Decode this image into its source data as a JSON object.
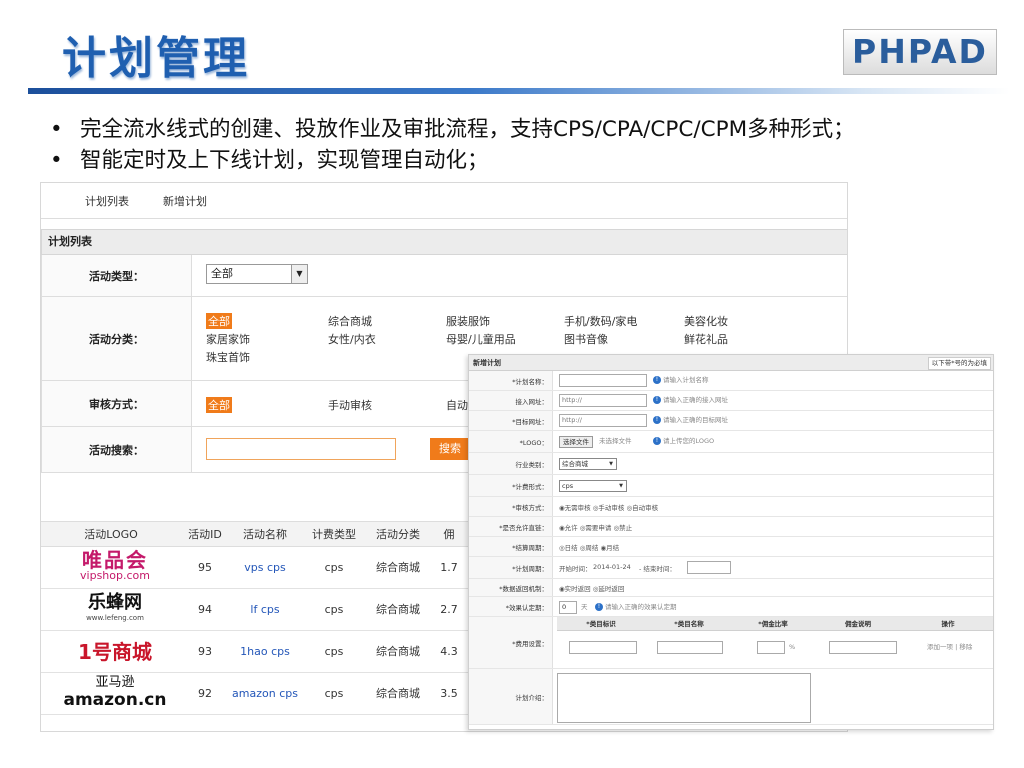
{
  "slide": {
    "title": "计划管理",
    "logo": "PHPAD",
    "bullets": [
      "完全流水线式的创建、投放作业及审批流程，支持CPS/CPA/CPC/CPM多种形式；",
      "智能定时及上下线计划，实现管理自动化；"
    ]
  },
  "list": {
    "tabs": [
      "计划列表",
      "新增计划"
    ],
    "section": "计划列表",
    "filters": {
      "type_label": "活动类型：",
      "type_value": "全部",
      "cat_label": "活动分类：",
      "categories": [
        "全部",
        "综合商城",
        "服装服饰",
        "手机/数码/家电",
        "美容化妆",
        "家居家饰",
        "女性/内衣",
        "母婴/儿童用品",
        "图书音像",
        "鲜花礼品",
        "珠宝首饰"
      ],
      "audit_label": "审核方式：",
      "audit_options": [
        "全部",
        "手动审核",
        "自动"
      ],
      "search_label": "活动搜索：",
      "search_button": "搜索"
    },
    "columns": [
      "活动LOGO",
      "活动ID",
      "活动名称",
      "计费类型",
      "活动分类",
      "佣"
    ],
    "rows": [
      {
        "logo_a": "唯品会",
        "logo_b": "vipshop.com",
        "id": "95",
        "name": "vps cps",
        "billing": "cps",
        "category": "综合商城",
        "rate": "1.7"
      },
      {
        "logo_a": "乐蜂网",
        "logo_b": "www.lefeng.com",
        "id": "94",
        "name": "lf cps",
        "billing": "cps",
        "category": "综合商城",
        "rate": "2.7"
      },
      {
        "logo_a": "1号商城",
        "logo_b": "",
        "id": "93",
        "name": "1hao cps",
        "billing": "cps",
        "category": "综合商城",
        "rate": "4.3"
      },
      {
        "logo_a": "亚马逊",
        "logo_b": "amazon.cn",
        "id": "92",
        "name": "amazon cps",
        "billing": "cps",
        "category": "综合商城",
        "rate": "3.5"
      }
    ]
  },
  "form": {
    "title": "新增计划",
    "note": "以下带*号的为必填",
    "fields": {
      "name_label": "*计划名称：",
      "name_hint": "请输入计划名称",
      "entry_label": "接入网址：",
      "entry_value": "http://",
      "entry_hint": "请输入正确的接入网址",
      "target_label": "*目标网址：",
      "target_value": "http://",
      "target_hint": "请输入正确的目标网址",
      "logo_label": "*LOGO：",
      "logo_button": "选择文件",
      "logo_file": "未选择文件",
      "logo_hint": "请上传您的LOGO",
      "industry_label": "行业类别：",
      "industry_value": "综合商城",
      "billing_label": "*计费形式：",
      "billing_value": "cps",
      "audit_label": "*审核方式：",
      "audit_value": "◉无需审核 ◎手动审核 ◎自动审核",
      "allow_label": "*是否允许直链：",
      "allow_value": "◉允许 ◎需要申请 ◎禁止",
      "settle_label": "*结算周期：",
      "settle_value": "◎日结 ◎周结 ◉月结",
      "period_label": "*计划周期：",
      "period_start_label": "开始时间：",
      "period_start": "2014-01-24",
      "period_end_label": "- 结束时间：",
      "return_label": "*数据返回机制：",
      "return_value": "◉实时返回 ◎延时返回",
      "effect_label": "*效果认定期：",
      "effect_value": "0",
      "effect_unit": "天",
      "effect_hint": "请输入正确的效果认定期",
      "fee_label": "*费用设置：",
      "fee_cols": [
        "*类目标识",
        "*类目名称",
        "*佣金比率",
        "佣金说明",
        "操作"
      ],
      "fee_unit": "%",
      "fee_action": "添加一项 | 移除",
      "intro_label": "计划介绍："
    }
  }
}
